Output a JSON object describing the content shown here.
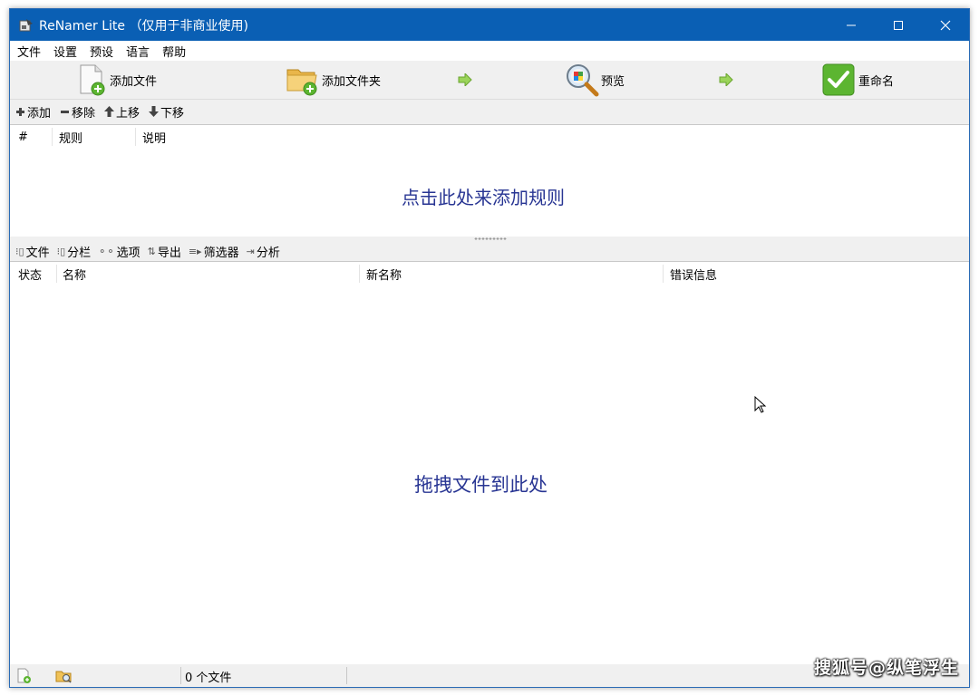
{
  "window": {
    "title": "ReNamer Lite （仅用于非商业使用)",
    "minimize_icon": "minimize-icon",
    "maximize_icon": "maximize-icon",
    "close_icon": "close-icon"
  },
  "menu": [
    "文件",
    "设置",
    "预设",
    "语言",
    "帮助"
  ],
  "toolbar": {
    "add_files": "添加文件",
    "add_folders": "添加文件夹",
    "preview": "预览",
    "rename": "重命名"
  },
  "rules_toolbar": {
    "add": "添加",
    "remove": "移除",
    "up": "上移",
    "down": "下移"
  },
  "rules_table": {
    "columns": [
      "#",
      "规则",
      "说明"
    ],
    "hint": "点击此处来添加规则"
  },
  "files_toolbar": {
    "files": "文件",
    "columns": "分栏",
    "options": "选项",
    "export": "导出",
    "filters": "筛选器",
    "analyze": "分析"
  },
  "files_table": {
    "columns": [
      "状态",
      "名称",
      "新名称",
      "错误信息"
    ],
    "hint": "拖拽文件到此处"
  },
  "status": {
    "file_count": "0 个文件"
  },
  "watermark": "搜狐号@纵笔浮生",
  "colors": {
    "titlebar": "#0a5fb4",
    "hint_text": "#283593",
    "rename_green": "#5cb531"
  }
}
